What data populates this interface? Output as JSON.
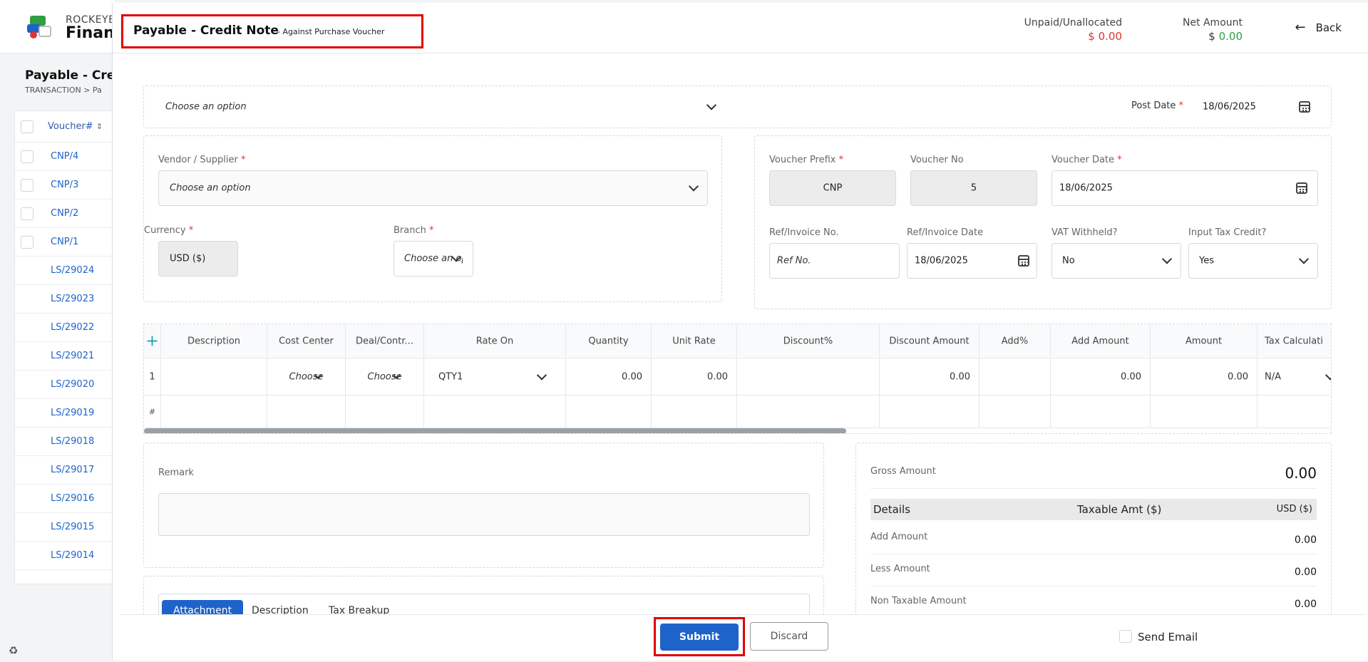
{
  "background": {
    "brand_top": "ROCKEYE",
    "brand_main": "Financ",
    "page_title": "Payable - Cred",
    "breadcrumb": "TRANSACTION   >   Pa",
    "table_header": "Voucher#",
    "rows": [
      "CNP/4",
      "CNP/3",
      "CNP/2",
      "CNP/1",
      "LS/29024",
      "LS/29023",
      "LS/29022",
      "LS/29021",
      "LS/29020",
      "LS/29019",
      "LS/29018",
      "LS/29017",
      "LS/29016",
      "LS/29015",
      "LS/29014"
    ],
    "footer_icon": "recycle-icon"
  },
  "modal": {
    "title": "Payable - Credit Note",
    "subtitle": "- Against Purchase Voucher",
    "unpaid_label": "Unpaid/Unallocated",
    "unpaid_currency": "$",
    "unpaid_value": "0.00",
    "net_label": "Net Amount",
    "net_currency": "$",
    "net_value": "0.00",
    "back_label": "Back",
    "colors": {
      "red": "#e03131",
      "green": "#2f9e44",
      "primary": "#1e63c9",
      "highlight": "#e00000"
    }
  },
  "top_bar": {
    "option_placeholder": "Choose an option",
    "post_date_label": "Post Date",
    "post_date_value": "18/06/2025"
  },
  "left_form": {
    "vendor_label": "Vendor / Supplier",
    "vendor_placeholder": "Choose an option",
    "currency_label": "Currency",
    "currency_value": "USD ($)",
    "branch_label": "Branch",
    "branch_placeholder": "Choose an op"
  },
  "right_form": {
    "prefix_label": "Voucher Prefix",
    "prefix_value": "CNP",
    "no_label": "Voucher No",
    "no_value": "5",
    "date_label": "Voucher Date",
    "date_value": "18/06/2025",
    "ref_label": "Ref/Invoice No.",
    "ref_placeholder": "Ref No.",
    "ref_date_label": "Ref/Invoice Date",
    "ref_date_value": "18/06/2025",
    "vat_label": "VAT Withheld?",
    "vat_value": "No",
    "itc_label": "Input Tax Credit?",
    "itc_value": "Yes"
  },
  "grid": {
    "headers": [
      "Description",
      "Cost Center",
      "Deal/Contr...",
      "Rate On",
      "Quantity",
      "Unit Rate",
      "Discount%",
      "Discount Amount",
      "Add%",
      "Add Amount",
      "Amount",
      "Tax Calculati"
    ],
    "row": {
      "index": "1",
      "cost_center": "Choose",
      "deal": "Choose",
      "rate_on": "QTY1",
      "quantity": "0.00",
      "unit_rate": "0.00",
      "discount_amount": "0.00",
      "add_amount": "0.00",
      "amount": "0.00",
      "tax": "N/A"
    },
    "footer_symbol": "#"
  },
  "remark": {
    "label": "Remark"
  },
  "tabs": [
    "Attachment",
    "Description",
    "Tax Breakup"
  ],
  "summary": {
    "gross_label": "Gross Amount",
    "gross_value": "0.00",
    "details_label": "Details",
    "taxable_label": "Taxable Amt ($)",
    "currency_label": "USD ($)",
    "add_label": "Add Amount",
    "add_value": "0.00",
    "less_label": "Less Amount",
    "less_value": "0.00",
    "nontax_label": "Non Taxable Amount",
    "nontax_value": "0.00"
  },
  "footer": {
    "submit_label": "Submit",
    "discard_label": "Discard",
    "send_email_label": "Send Email"
  }
}
